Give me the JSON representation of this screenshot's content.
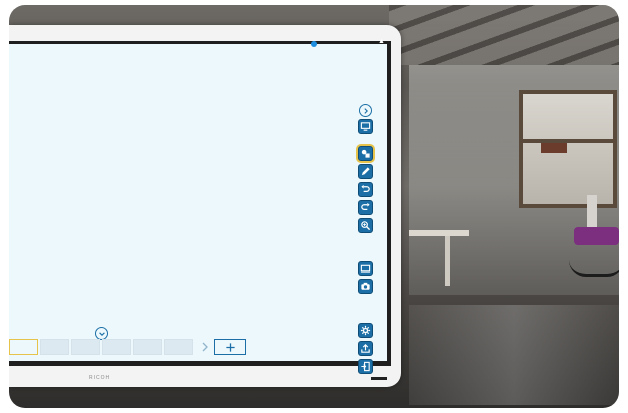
{
  "brand": {
    "logo_text": "RICOH"
  },
  "toolbar": {
    "expand_icon": "chevron-right-circle-icon",
    "tools": [
      {
        "id": "display",
        "icon": "monitor-icon"
      },
      {
        "id": "shapes",
        "icon": "shapes-icon",
        "active": true
      },
      {
        "id": "pen",
        "icon": "pen-icon"
      },
      {
        "id": "undo",
        "icon": "undo-icon"
      },
      {
        "id": "redo",
        "icon": "redo-icon"
      },
      {
        "id": "zoom",
        "icon": "zoom-icon"
      },
      {
        "id": "screen",
        "icon": "screen-icon"
      },
      {
        "id": "capture",
        "icon": "camera-icon"
      },
      {
        "id": "settings",
        "icon": "gear-icon"
      },
      {
        "id": "export",
        "icon": "export-icon"
      },
      {
        "id": "exit",
        "icon": "exit-icon"
      }
    ]
  },
  "pages": {
    "thumbnail_count": 6,
    "active_index": 0,
    "collapse_icon": "chevron-down-circle-icon",
    "next_icon": "chevron-right-icon",
    "add_icon": "plus-icon"
  },
  "colors": {
    "accent": "#1b6fa6",
    "canvas": "#ecf8fc",
    "active_outline": "#e6c34a",
    "status_dot": "#1e8fe0"
  }
}
